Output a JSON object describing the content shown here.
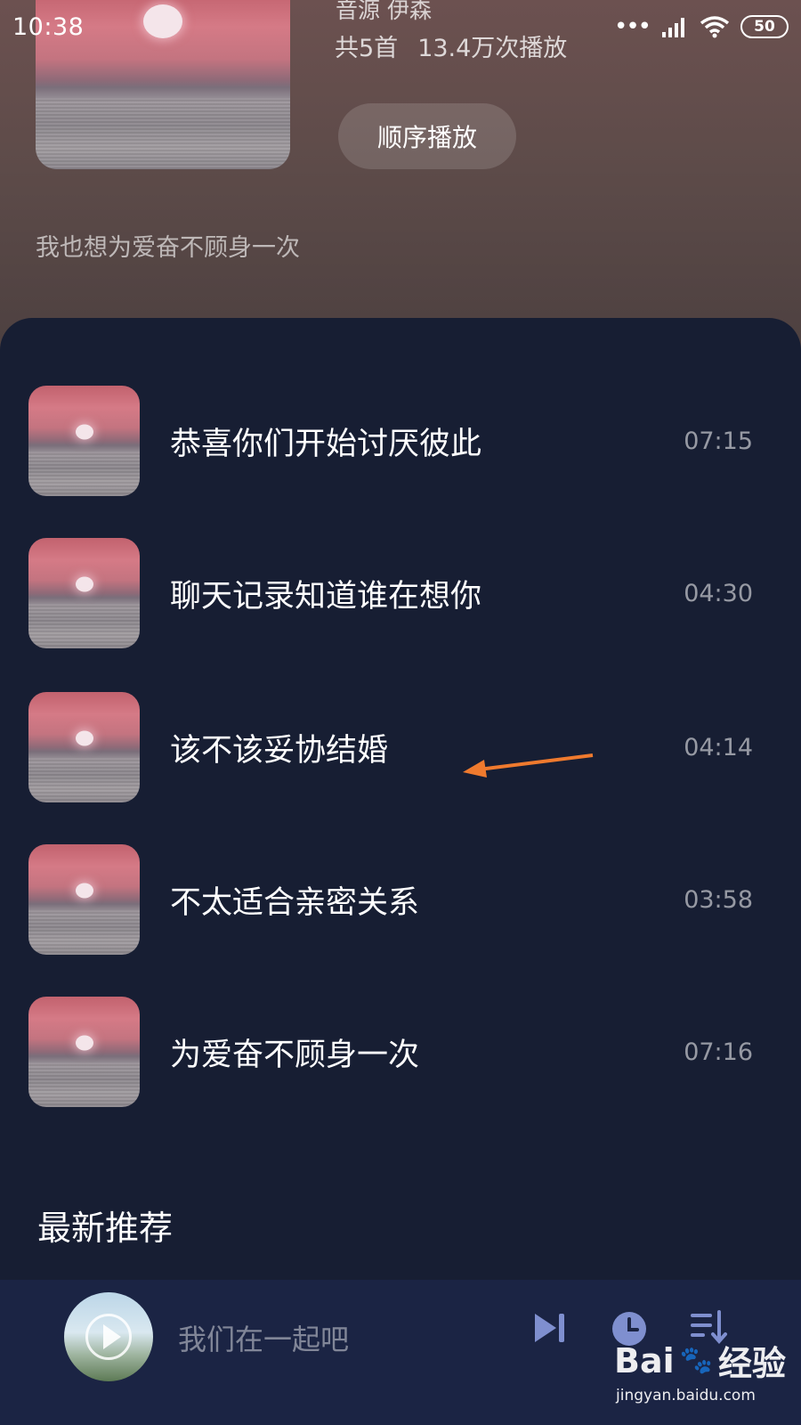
{
  "status_bar": {
    "time": "10:38",
    "battery": "50"
  },
  "album": {
    "artist_line": "音源  伊森",
    "song_count": "共5首",
    "play_count": "13.4万次播放",
    "play_order_label": "顺序播放",
    "description": "我也想为爱奋不顾身一次"
  },
  "songs": [
    {
      "title": "恭喜你们开始讨厌彼此",
      "duration": "07:15"
    },
    {
      "title": "聊天记录知道谁在想你",
      "duration": "04:30"
    },
    {
      "title": "该不该妥协结婚",
      "duration": "04:14"
    },
    {
      "title": "不太适合亲密关系",
      "duration": "03:58"
    },
    {
      "title": "为爱奋不顾身一次",
      "duration": "07:16"
    }
  ],
  "section_title": "最新推荐",
  "mini_player": {
    "title": "我们在一起吧"
  },
  "watermark": {
    "brand_a": "Bai",
    "brand_b": "经验",
    "url": "jingyan.baidu.com"
  },
  "colors": {
    "sheet": "#171e33",
    "player": "#1b2444",
    "icon": "#7f8fcf",
    "arrow": "#ef7a2e"
  },
  "icons": [
    "signal-icon",
    "wifi-icon",
    "next-icon",
    "timer-icon",
    "playlist-icon",
    "arrow-annotation-icon"
  ]
}
